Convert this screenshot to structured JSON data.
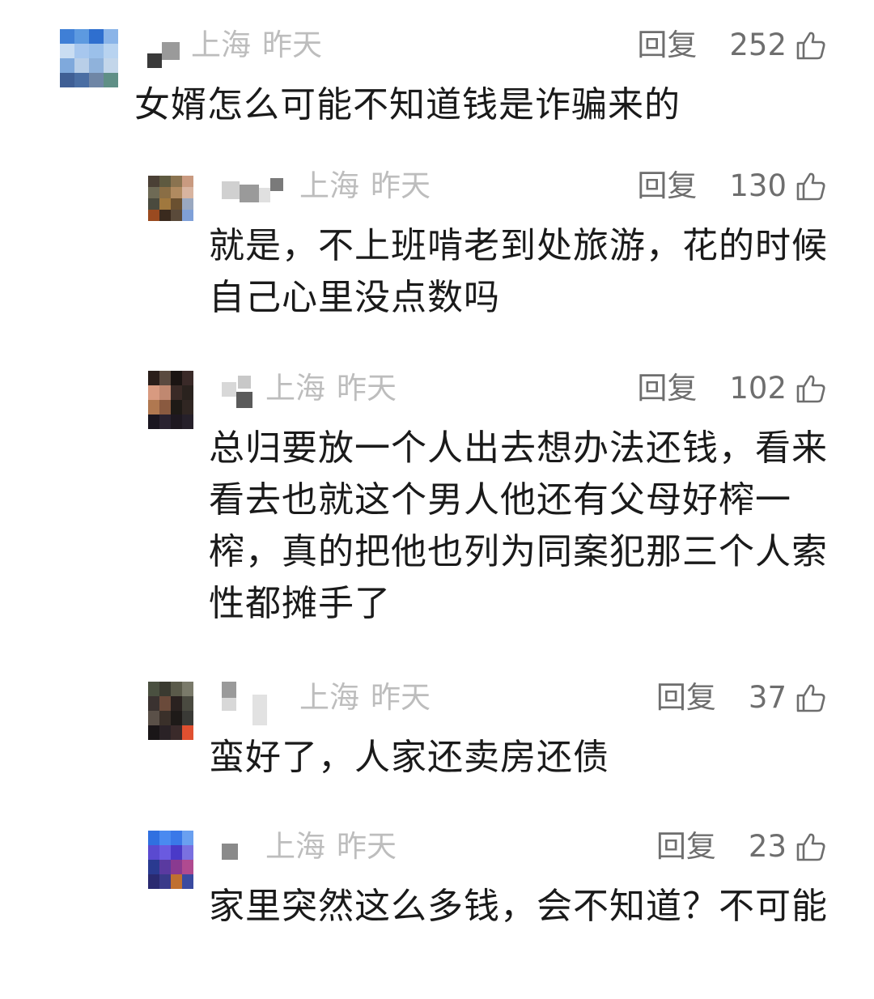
{
  "comments": [
    {
      "location": "上海",
      "time": "昨天",
      "reply_label": "回复",
      "likes": "252",
      "text": "女婿怎么可能不知道钱是诈骗来的",
      "avatar_icon": "blurred-avatar",
      "avatar_colors": [
        "#3f7fd6",
        "#5d9ae0",
        "#2f6fcf",
        "#8ab4e8",
        "#c9ddf2",
        "#a7c7ee",
        "#9bc0ea",
        "#b8d3f0",
        "#7fa9dc",
        "#b9cfe8",
        "#8fb2db",
        "#c3d6ea",
        "#3f5f95",
        "#4a6ea3",
        "#6f86a6",
        "#5f8f86"
      ]
    },
    {
      "location": "上海",
      "time": "昨天",
      "reply_label": "回复",
      "likes": "130",
      "text": "就是，不上班啃老到处旅游，花的时候自己心里没点数吗",
      "avatar_icon": "blurred-avatar",
      "avatar_colors": [
        "#4a4035",
        "#5e5a40",
        "#8a7350",
        "#c99a80",
        "#6e6a55",
        "#8a6e45",
        "#b08a60",
        "#d8b4a0",
        "#4a4a3e",
        "#a0783e",
        "#6a5030",
        "#9aa8c0",
        "#9a4a20",
        "#3a2a1e",
        "#5a4a3a",
        "#7fa0d8"
      ]
    },
    {
      "location": "上海",
      "time": "昨天",
      "reply_label": "回复",
      "likes": "102",
      "text": "总归要放一个人出去想办法还钱，看来看去也就这个男人他还有父母好榨一榨，真的把他也列为同案犯那三个人索性都摊手了",
      "avatar_icon": "blurred-avatar",
      "avatar_colors": [
        "#2a1e1a",
        "#5a4a40",
        "#1a1412",
        "#3a2a28",
        "#d89a80",
        "#c08870",
        "#3a2a26",
        "#2a221e",
        "#b07850",
        "#8a5a40",
        "#1e1a16",
        "#302622",
        "#1a1620",
        "#2a2230",
        "#1e1820",
        "#26202a"
      ]
    },
    {
      "location": "上海",
      "time": "昨天",
      "reply_label": "回复",
      "likes": "37",
      "text": "蛮好了，人家还卖房还债",
      "avatar_icon": "blurred-avatar",
      "avatar_colors": [
        "#4a5040",
        "#3a3a30",
        "#5a5a4a",
        "#7a7a6a",
        "#3a3230",
        "#6a4a3a",
        "#2a2220",
        "#4a4a40",
        "#5a5048",
        "#3a302a",
        "#1e1a18",
        "#3a3a36",
        "#1a1618",
        "#2a2226",
        "#3a2a2a",
        "#e05030"
      ]
    },
    {
      "location": "上海",
      "time": "昨天",
      "reply_label": "回复",
      "likes": "23",
      "text": "家里突然这么多钱，会不知道？不可能",
      "avatar_icon": "blurred-avatar",
      "avatar_colors": [
        "#3070e0",
        "#4a8af0",
        "#3a78e8",
        "#6aa0f0",
        "#5a4ad0",
        "#6a5ae0",
        "#4a3ac8",
        "#7a70e0",
        "#2a3a90",
        "#5a3aa0",
        "#8a3a90",
        "#b04a90",
        "#2a2a70",
        "#3a3a8a",
        "#c07030",
        "#3a4aa0"
      ]
    }
  ]
}
